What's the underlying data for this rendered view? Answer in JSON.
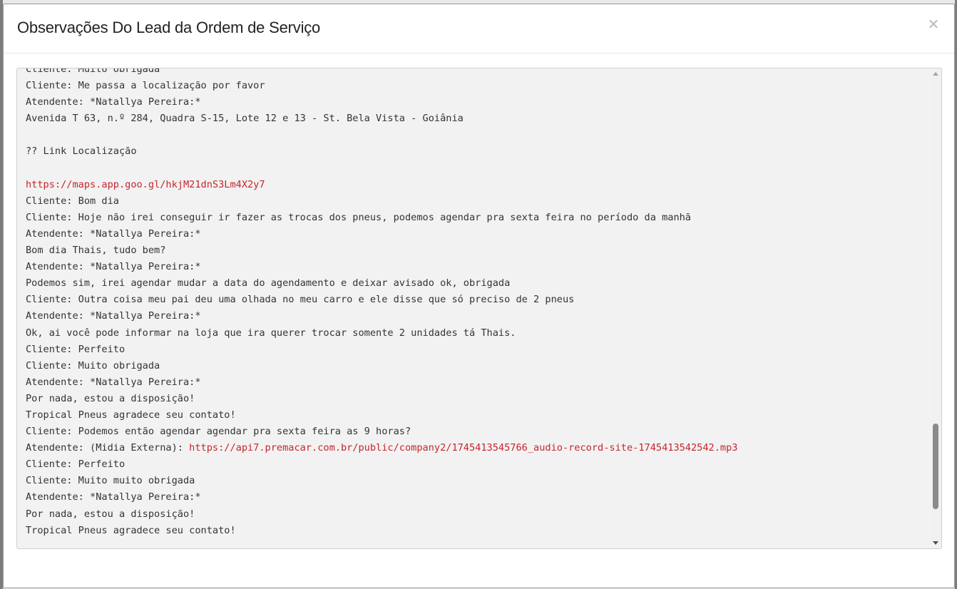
{
  "modal": {
    "title": "Observações Do Lead da Ordem de Serviço",
    "close_symbol": "×"
  },
  "icons": {
    "close": "close-icon",
    "scroll_up": "chevron-up-icon",
    "scroll_down": "chevron-down-icon"
  },
  "colors": {
    "link": "#c7252c",
    "text": "#333333",
    "textarea_bg": "#f2f2f2"
  },
  "observations": {
    "lines": [
      {
        "text": "Cliente: Muito obrigada"
      },
      {
        "text": "Cliente: Me passa a localização por favor"
      },
      {
        "text": "Atendente: *Natallya Pereira:*"
      },
      {
        "text": "Avenida T 63, n.º 284, Quadra S-15, Lote 12 e 13 - St. Bela Vista - Goiânia"
      },
      {
        "text": ""
      },
      {
        "text": "?? Link Localização"
      },
      {
        "text": ""
      },
      {
        "text": "",
        "link": "https://maps.app.goo.gl/hkjM21dnS3Lm4X2y7"
      },
      {
        "text": "Cliente: Bom dia"
      },
      {
        "text": "Cliente: Hoje não irei conseguir ir fazer as trocas dos pneus, podemos agendar pra sexta feira no período da manhã"
      },
      {
        "text": "Atendente: *Natallya Pereira:*"
      },
      {
        "text": "Bom dia Thais, tudo bem?"
      },
      {
        "text": "Atendente: *Natallya Pereira:*"
      },
      {
        "text": "Podemos sim, irei agendar mudar a data do agendamento e deixar avisado ok, obrigada"
      },
      {
        "text": "Cliente: Outra coisa meu pai deu uma olhada no meu carro e ele disse que só preciso de 2 pneus"
      },
      {
        "text": "Atendente: *Natallya Pereira:*"
      },
      {
        "text": "Ok, ai você pode informar na loja que ira querer trocar somente 2 unidades tá Thais."
      },
      {
        "text": "Cliente: Perfeito"
      },
      {
        "text": "Cliente: Muito obrigada"
      },
      {
        "text": "Atendente: *Natallya Pereira:*"
      },
      {
        "text": "Por nada, estou a disposição!"
      },
      {
        "text": "Tropical Pneus agradece seu contato!"
      },
      {
        "text": "Cliente: Podemos então agendar agendar pra sexta feira as 9 horas?"
      },
      {
        "text": "Atendente: (Midia Externa): ",
        "link": "https://api7.premacar.com.br/public/company2/1745413545766_audio-record-site-1745413542542.mp3"
      },
      {
        "text": "Cliente: Perfeito"
      },
      {
        "text": "Cliente: Muito muito obrigada"
      },
      {
        "text": "Atendente: *Natallya Pereira:*"
      },
      {
        "text": "Por nada, estou a disposição!"
      },
      {
        "text": "Tropical Pneus agradece seu contato!"
      }
    ]
  }
}
